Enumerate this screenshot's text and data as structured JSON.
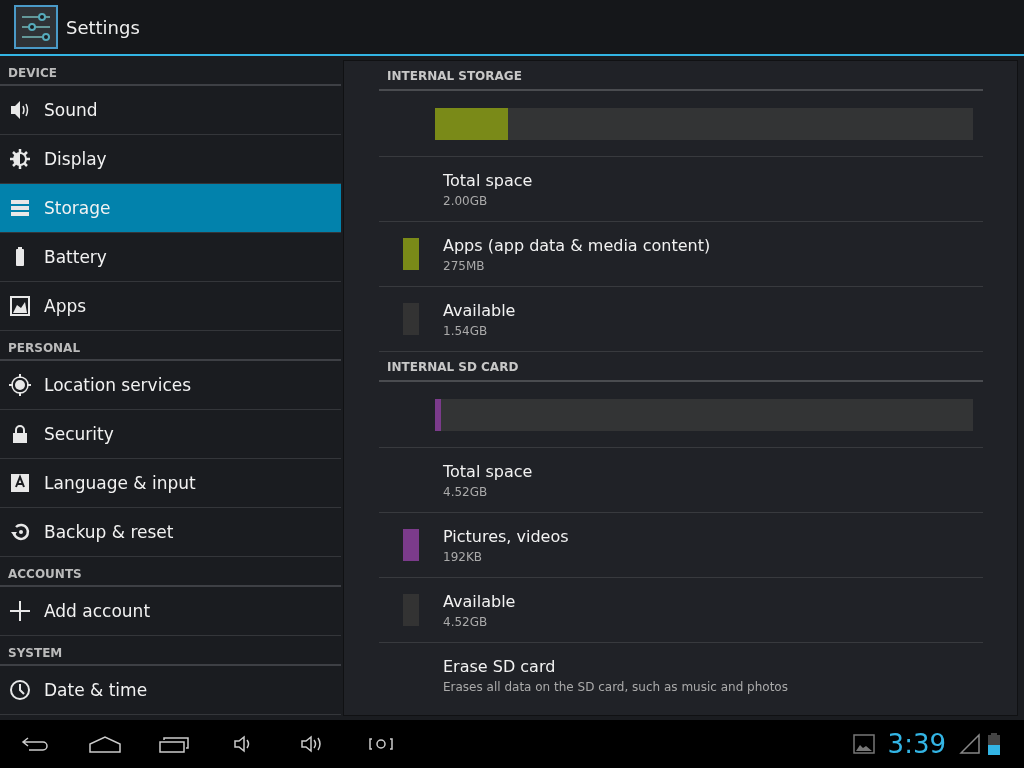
{
  "action_bar": {
    "title": "Settings"
  },
  "sidebar": {
    "sections": [
      {
        "header": "DEVICE",
        "items": [
          {
            "label": "Sound",
            "selected": false
          },
          {
            "label": "Display",
            "selected": false
          },
          {
            "label": "Storage",
            "selected": true
          },
          {
            "label": "Battery",
            "selected": false
          },
          {
            "label": "Apps",
            "selected": false
          }
        ]
      },
      {
        "header": "PERSONAL",
        "items": [
          {
            "label": "Location services",
            "selected": false
          },
          {
            "label": "Security",
            "selected": false
          },
          {
            "label": "Language & input",
            "selected": false
          },
          {
            "label": "Backup & reset",
            "selected": false
          }
        ]
      },
      {
        "header": "ACCOUNTS",
        "items": [
          {
            "label": "Add account",
            "selected": false
          }
        ]
      },
      {
        "header": "SYSTEM",
        "items": [
          {
            "label": "Date & time",
            "selected": false
          }
        ]
      }
    ]
  },
  "storage": {
    "sections": [
      {
        "header": "INTERNAL STORAGE",
        "bar": {
          "segments": [
            {
              "level": 0.135,
              "color": "#7a8a18"
            }
          ]
        },
        "rows": [
          {
            "kind": "total",
            "title": "Total space",
            "value": "2.00GB"
          },
          {
            "kind": "segment",
            "title": "Apps (app data & media content)",
            "value": "275MB",
            "color": "#7a8a18"
          },
          {
            "kind": "segment",
            "title": "Available",
            "value": "1.54GB",
            "color": "#333333"
          }
        ]
      },
      {
        "header": "INTERNAL SD CARD",
        "bar": {
          "segments": [
            {
              "level": 0.011,
              "color": "#7b3b8b"
            }
          ]
        },
        "rows": [
          {
            "kind": "total",
            "title": "Total space",
            "value": "4.52GB"
          },
          {
            "kind": "segment",
            "title": "Pictures, videos",
            "value": "192KB",
            "color": "#7b3b8b"
          },
          {
            "kind": "segment",
            "title": "Available",
            "value": "4.52GB",
            "color": "#333333"
          },
          {
            "kind": "action",
            "title": "Erase SD card",
            "value": "Erases all data on the SD card, such as music and photos"
          }
        ]
      }
    ]
  },
  "system_bar": {
    "time": "3:39"
  }
}
